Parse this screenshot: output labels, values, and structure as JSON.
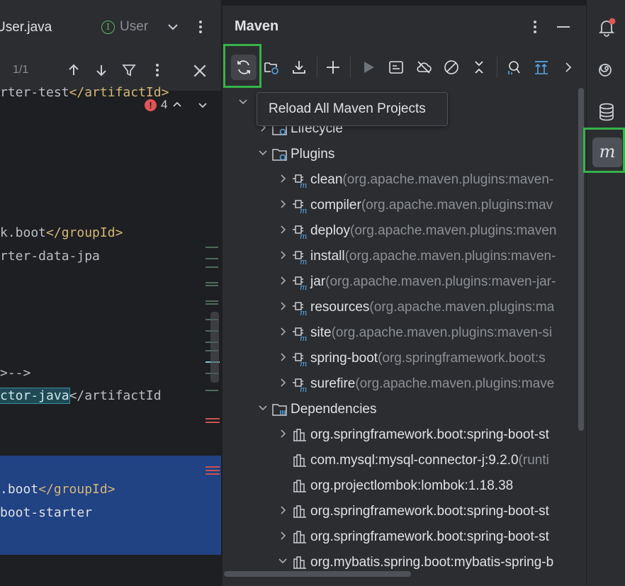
{
  "editor": {
    "tabs": [
      {
        "label": "User.java",
        "visible_text": "User.java"
      },
      {
        "label": "User",
        "visible_text": "User"
      }
    ],
    "find": {
      "count": "1/1"
    },
    "problems": {
      "count": "4"
    },
    "code_lines": [
      {
        "pre": "rter-test",
        "tag": "</artifactId>"
      },
      {
        "pre": "k.boot",
        "tag": "</groupId>"
      },
      {
        "pre": "rter-data-jpa",
        "tag": ""
      },
      {
        "pre": ">-->",
        "tag": ""
      },
      {
        "hl": "ctor-java",
        "tag": "</artifactId"
      },
      {
        "pre": ".boot",
        "tag": "</groupId>"
      },
      {
        "pre": "boot-starter",
        "tag": ""
      }
    ]
  },
  "maven": {
    "title": "Maven",
    "tooltip": "Reload All Maven Projects",
    "tree": [
      {
        "label": "Lifecycle",
        "detail": "",
        "level": 1,
        "chevron": "right",
        "icon": "folder-gear-icon"
      },
      {
        "label": "Plugins",
        "detail": "",
        "level": 1,
        "chevron": "down",
        "icon": "folder-gear-icon"
      },
      {
        "label": "clean",
        "detail": " (org.apache.maven.plugins:maven-",
        "level": 2,
        "chevron": "right",
        "icon": "maven-plugin-icon"
      },
      {
        "label": "compiler",
        "detail": " (org.apache.maven.plugins:mav",
        "level": 2,
        "chevron": "right",
        "icon": "maven-plugin-icon"
      },
      {
        "label": "deploy",
        "detail": " (org.apache.maven.plugins:maven",
        "level": 2,
        "chevron": "right",
        "icon": "maven-plugin-icon"
      },
      {
        "label": "install",
        "detail": " (org.apache.maven.plugins:maven-",
        "level": 2,
        "chevron": "right",
        "icon": "maven-plugin-icon"
      },
      {
        "label": "jar",
        "detail": " (org.apache.maven.plugins:maven-jar-",
        "level": 2,
        "chevron": "right",
        "icon": "maven-plugin-icon"
      },
      {
        "label": "resources",
        "detail": " (org.apache.maven.plugins:ma",
        "level": 2,
        "chevron": "right",
        "icon": "maven-plugin-icon"
      },
      {
        "label": "site",
        "detail": " (org.apache.maven.plugins:maven-si",
        "level": 2,
        "chevron": "right",
        "icon": "maven-plugin-icon"
      },
      {
        "label": "spring-boot",
        "detail": " (org.springframework.boot:s",
        "level": 2,
        "chevron": "right",
        "icon": "maven-plugin-icon"
      },
      {
        "label": "surefire",
        "detail": " (org.apache.maven.plugins:mave",
        "level": 2,
        "chevron": "right",
        "icon": "maven-plugin-icon"
      },
      {
        "label": "Dependencies",
        "detail": "",
        "level": 1,
        "chevron": "down",
        "icon": "folder-library-icon"
      },
      {
        "label": "org.springframework.boot:spring-boot-st",
        "detail": "",
        "level": 2,
        "chevron": "right",
        "icon": "library-icon"
      },
      {
        "label": "com.mysql:mysql-connector-j:9.2.0",
        "detail": " (runti",
        "level": 2,
        "chevron": "none",
        "icon": "library-icon"
      },
      {
        "label": "org.projectlombok:lombok:1.18.38",
        "detail": "",
        "level": 2,
        "chevron": "none",
        "icon": "library-icon"
      },
      {
        "label": "org.springframework.boot:spring-boot-st",
        "detail": "",
        "level": 2,
        "chevron": "right",
        "icon": "library-icon"
      },
      {
        "label": "org.springframework.boot:spring-boot-st",
        "detail": "",
        "level": 2,
        "chevron": "right",
        "icon": "library-icon"
      },
      {
        "label": "org.mybatis.spring.boot:mybatis-spring-b",
        "detail": "",
        "level": 2,
        "chevron": "down",
        "icon": "library-icon"
      }
    ]
  },
  "colors": {
    "focus_outline": "#35b24a",
    "selection": "#214283",
    "error": "#e05555",
    "notification_dot": "#e05555"
  }
}
